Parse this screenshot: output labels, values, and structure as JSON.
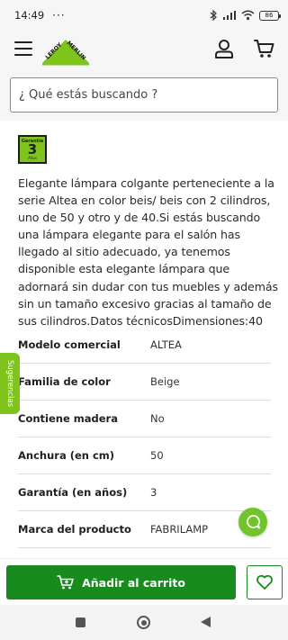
{
  "status_bar": {
    "time": "14:49",
    "dots": "···",
    "battery": "86"
  },
  "header": {
    "logo_text": "LEROY MERLIN"
  },
  "search": {
    "placeholder": "¿ Qué estás buscando ?"
  },
  "warranty_badge": {
    "top_label": "Garantía",
    "years": "3",
    "unit": "Años"
  },
  "product": {
    "description": "Elegante lámpara colgante perteneciente a la serie Altea en color beis/ beis con 2 cilindros, uno de 50 y otro y de 40.Si estás buscando una lámpara elegante para el salón has llegado al sitio adecuado, ya tenemos disponible esta elegante lámpara que adornará sin dudar con tus muebles y además sin un tamaño excesivo gracias al tamaño de sus cilindros.Datos técnicosDimensiones:40"
  },
  "specs": [
    {
      "label": "Modelo comercial",
      "value": "ALTEA"
    },
    {
      "label": "Familia de color",
      "value": "Beige"
    },
    {
      "label": "Contiene madera",
      "value": "No"
    },
    {
      "label": "Anchura (en cm)",
      "value": "50"
    },
    {
      "label": "Garantía (en años)",
      "value": "3"
    },
    {
      "label": "Marca del producto",
      "value": "FABRILAMP"
    }
  ],
  "side_tab": {
    "label": "Sugerencias"
  },
  "actions": {
    "add_to_cart_label": "Añadir al carrito"
  },
  "colors": {
    "brand_green": "#7fc41c",
    "button_green": "#188a1e"
  },
  "icons": {
    "menu": "hamburger-menu-icon",
    "user": "user-icon",
    "cart": "cart-icon",
    "chat": "chat-icon",
    "heart": "heart-icon"
  }
}
